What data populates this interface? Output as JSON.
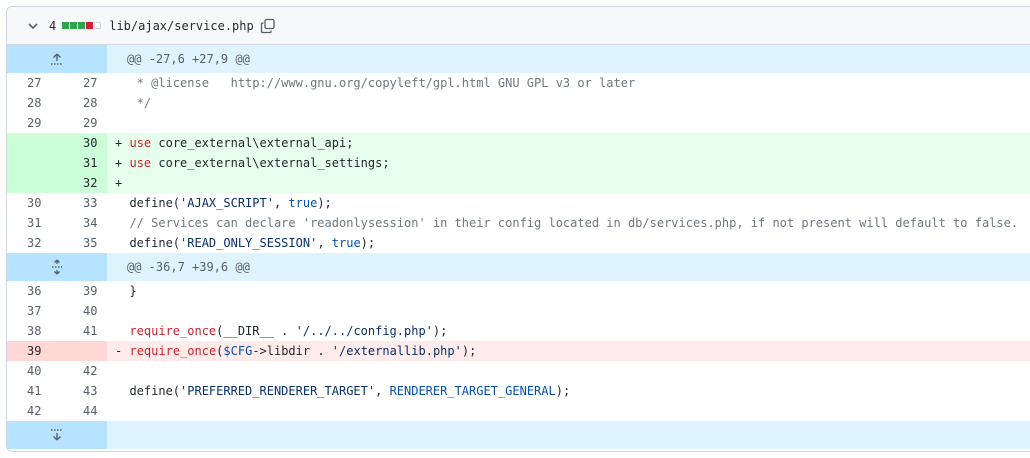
{
  "file": {
    "collapse_icon": "chevron-down-icon",
    "changes_count": "4",
    "diffstat_colors": [
      "#2da44e",
      "#2da44e",
      "#2da44e",
      "#cf222e",
      "#d0d7de"
    ],
    "path": "lib/ajax/service.php",
    "copy_icon": "copy-icon"
  },
  "hunks": {
    "first": "@@ -27,6 +27,9 @@",
    "second": "@@ -36,7 +39,6 @@"
  },
  "lines": [
    {
      "old": "27",
      "new": "27",
      "type": "ctx",
      "text": " * @license   http://www.gnu.org/copyleft/gpl.html GNU GPL v3 or later"
    },
    {
      "old": "28",
      "new": "28",
      "type": "ctx",
      "text": " */"
    },
    {
      "old": "29",
      "new": "29",
      "type": "ctx",
      "text": ""
    },
    {
      "old": "",
      "new": "30",
      "type": "add",
      "kw": "use",
      "text": " core_external\\external_api;"
    },
    {
      "old": "",
      "new": "31",
      "type": "add",
      "kw": "use",
      "text": " core_external\\external_settings;"
    },
    {
      "old": "",
      "new": "32",
      "type": "add",
      "text": ""
    },
    {
      "old": "30",
      "new": "33",
      "type": "ctx",
      "text": "define('AJAX_SCRIPT', true);"
    },
    {
      "old": "31",
      "new": "34",
      "type": "ctx",
      "text": "// Services can declare 'readonlysession' in their config located in db/services.php, if not present will default to false."
    },
    {
      "old": "32",
      "new": "35",
      "type": "ctx",
      "text": "define('READ_ONLY_SESSION', true);"
    },
    {
      "old": "36",
      "new": "39",
      "type": "ctx",
      "text": "}"
    },
    {
      "old": "37",
      "new": "40",
      "type": "ctx",
      "text": ""
    },
    {
      "old": "38",
      "new": "41",
      "type": "ctx",
      "text": "require_once(__DIR__ . '/../../config.php');"
    },
    {
      "old": "39",
      "new": "",
      "type": "del",
      "text": "require_once($CFG->libdir . '/externallib.php');"
    },
    {
      "old": "40",
      "new": "42",
      "type": "ctx",
      "text": ""
    },
    {
      "old": "41",
      "new": "43",
      "type": "ctx",
      "text": "define('PREFERRED_RENDERER_TARGET', RENDERER_TARGET_GENERAL);"
    },
    {
      "old": "42",
      "new": "44",
      "type": "ctx",
      "text": ""
    }
  ],
  "tokens": {
    "l6": {
      "a": "define(",
      "b": "'AJAX_SCRIPT'",
      "c": ", ",
      "d": "true",
      "e": ");"
    },
    "l8": {
      "a": "define(",
      "b": "'READ_ONLY_SESSION'",
      "c": ", ",
      "d": "true",
      "e": ");"
    },
    "l11": {
      "a": "require_once",
      "b": "(__DIR__ . ",
      "c": "'/../../config.php'",
      "d": ");"
    },
    "l12": {
      "a": "require_once",
      "b": "(",
      "c": "$CFG",
      "d": "->libdir . ",
      "e": "'/externallib.php'",
      "f": ");"
    },
    "l14": {
      "a": "define(",
      "b": "'PREFERRED_RENDERER_TARGET'",
      "c": ", ",
      "d": "RENDERER_TARGET_GENERAL",
      "e": ");"
    }
  },
  "markers": {
    "add": "+",
    "del": "-"
  }
}
